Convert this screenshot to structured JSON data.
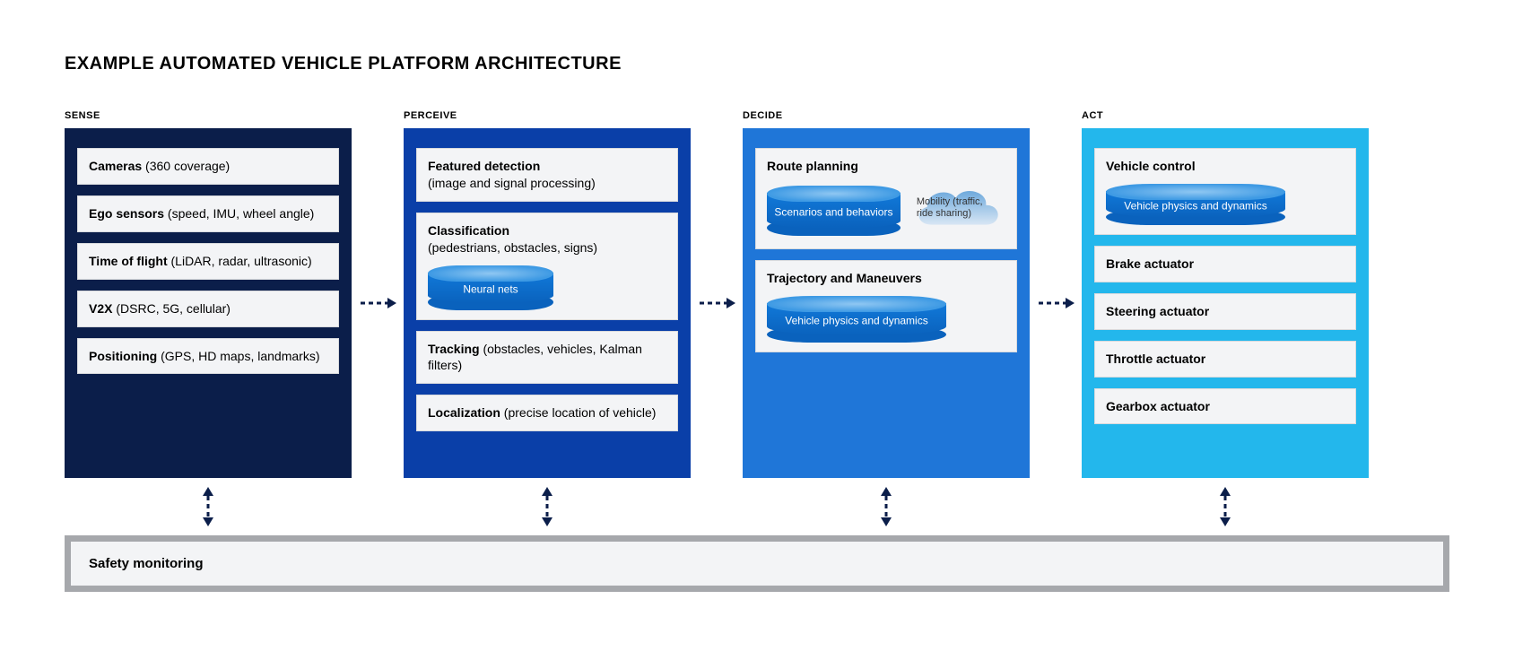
{
  "title": "EXAMPLE AUTOMATED VEHICLE PLATFORM ARCHITECTURE",
  "stages": {
    "sense": {
      "label": "SENSE",
      "items": [
        {
          "bold": "Cameras",
          "rest": " (360 coverage)"
        },
        {
          "bold": "Ego sensors",
          "rest": " (speed, IMU, wheel angle)"
        },
        {
          "bold": "Time of flight",
          "rest": " (LiDAR, radar, ultrasonic)"
        },
        {
          "bold": "V2X",
          "rest": " (DSRC, 5G, cellular)"
        },
        {
          "bold": "Positioning",
          "rest": " (GPS, HD maps, landmarks)"
        }
      ]
    },
    "perceive": {
      "label": "PERCEIVE",
      "featured": {
        "bold": "Featured detection",
        "rest": "(image and signal processing)"
      },
      "classification": {
        "bold": "Classification",
        "rest": "(pedestrians, obstacles, signs)",
        "cyl": "Neural nets"
      },
      "tracking": {
        "bold": "Tracking",
        "rest": " (obstacles, vehicles, Kalman filters)"
      },
      "localization": {
        "bold": "Localization",
        "rest": " (precise location of vehicle)"
      }
    },
    "decide": {
      "label": "DECIDE",
      "route": {
        "bold": "Route planning",
        "cyl": "Scenarios and behaviors",
        "cloud": "Mobility (traffic, ride sharing)"
      },
      "traj": {
        "bold": "Trajectory and Maneuvers",
        "cyl": "Vehicle physics and dynamics"
      }
    },
    "act": {
      "label": "ACT",
      "control": {
        "bold": "Vehicle control",
        "cyl": "Vehicle physics and dynamics"
      },
      "items": [
        "Brake actuator",
        "Steering actuator",
        "Throttle actuator",
        "Gearbox actuator"
      ]
    }
  },
  "safety": "Safety monitoring",
  "colors": {
    "sense": "#0b1e4a",
    "perceive": "#0a3fa8",
    "decide": "#1f76d8",
    "act": "#23b7ec",
    "arrow": "#0b1e4a"
  }
}
